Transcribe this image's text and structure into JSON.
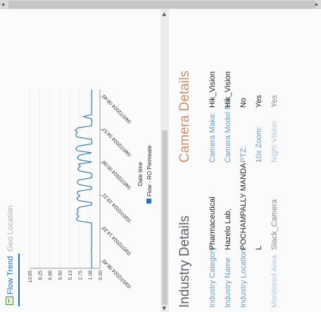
{
  "tabs": [
    {
      "label": "Flow Trend",
      "icon": "chart-icon",
      "active": true
    },
    {
      "label": "Geo Location",
      "active": false
    }
  ],
  "industry": {
    "title": "Industry Details",
    "rows": [
      {
        "label": "Industry Category",
        "value": "Pharmaceutical"
      },
      {
        "label": "Industry Name",
        "value": "Hazelo Lab,"
      },
      {
        "label": "Industry Location:",
        "value": "POCHAMPALLY MANDA"
      },
      {
        "label": "",
        "value": "L"
      },
      {
        "label": "Monitored Area",
        "value": "Slack_Camera"
      }
    ]
  },
  "camera": {
    "title": "Camera Details",
    "rows": [
      {
        "label": "Camera Make:",
        "value": "Hik_Vision"
      },
      {
        "label": "Camera Model No:",
        "value": "Hik_Vision"
      },
      {
        "label": "PTZ:",
        "value": "No"
      },
      {
        "label": "10x Zoom:",
        "value": "Yes"
      },
      {
        "label": "Night Vision:",
        "value": "Yes"
      }
    ]
  },
  "chart_data": {
    "type": "line",
    "xlabel": "Date time",
    "ylabel": "",
    "series": [
      {
        "name": "Flow - RO Permeate",
        "color": "#2f6fa6",
        "values": [
          1.55,
          1.6,
          1.58,
          1.62,
          1.6,
          1.65,
          1.62,
          1.6,
          1.7,
          1.6,
          1.62,
          1.58,
          1.6,
          1.65,
          1.6,
          1.62,
          1.6,
          1.58,
          1.6,
          1.62,
          1.6,
          4.3,
          4.6,
          4.1,
          4.5,
          4.2,
          4.4,
          4.0,
          1.6,
          1.58,
          4.2,
          4.5,
          3.9,
          4.4,
          4.3,
          1.6,
          1.62,
          4.1,
          4.4,
          4.2,
          1.6,
          1.58,
          1.62,
          4.0,
          4.3,
          3.8,
          4.2,
          1.6,
          4.1,
          4.4,
          4.0,
          1.62,
          4.5,
          4.7,
          4.2,
          1.6,
          1.58,
          1.62,
          4.5,
          4.7,
          4.4,
          4.8,
          4.3,
          1.62,
          1.6,
          1.58,
          1.6,
          3.2,
          1.6,
          1.62,
          1.58,
          1.6,
          1.62,
          1.6,
          1.58,
          1.6,
          1.62,
          1.6,
          1.58,
          1.6
        ]
      }
    ],
    "yticks": [
      "0.00",
      "1.38",
      "2.75",
      "5.13",
      "5.50",
      "6.88",
      "8.25",
      "13.65"
    ],
    "xticks": [
      "03/07/2024 06:45",
      "03/07/2024 14:33",
      "03/07/2024 19:21",
      "04/07/2024 00:09",
      "04/07/2024 04:57",
      "04/07/2024 09:45"
    ],
    "ylim": [
      0,
      13.65
    ],
    "legend_position": "bottom"
  }
}
